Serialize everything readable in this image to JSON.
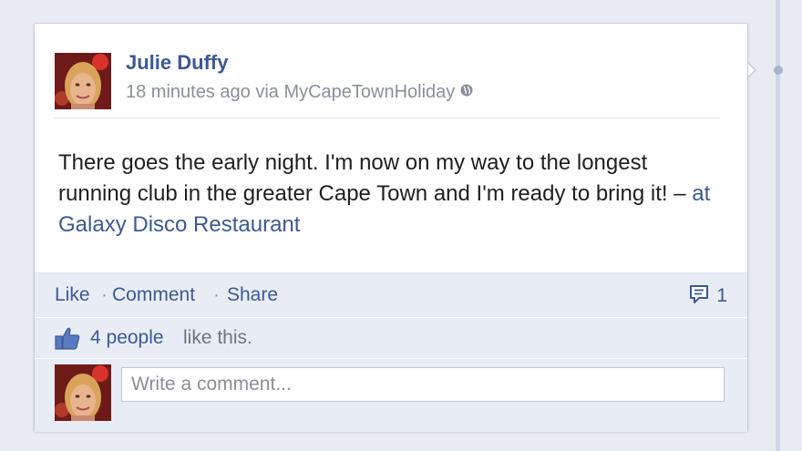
{
  "post": {
    "author": "Julie Duffy",
    "time": "18 minutes ago via MyCapeTownHoliday",
    "audience_icon": "globe-icon",
    "text": "There goes the early night. I'm now on my way to the longest running club in the greater Cape Town and I'm ready to bring it! – ",
    "place": "at Galaxy Disco Restaurant"
  },
  "actions": {
    "like": "Like",
    "comment": "Comment",
    "share": "Share",
    "separator": "·",
    "comment_count": "1",
    "comment_count_icon": "comment-bubble-icon"
  },
  "likes": {
    "icon": "thumbs-up-icon",
    "people": "4 people",
    "suffix": "like this."
  },
  "comment_box": {
    "placeholder": "Write a comment..."
  },
  "colors": {
    "link": "#3b5998",
    "footer_bg": "#e8ecf4",
    "timeline": "#cfd6e6"
  }
}
